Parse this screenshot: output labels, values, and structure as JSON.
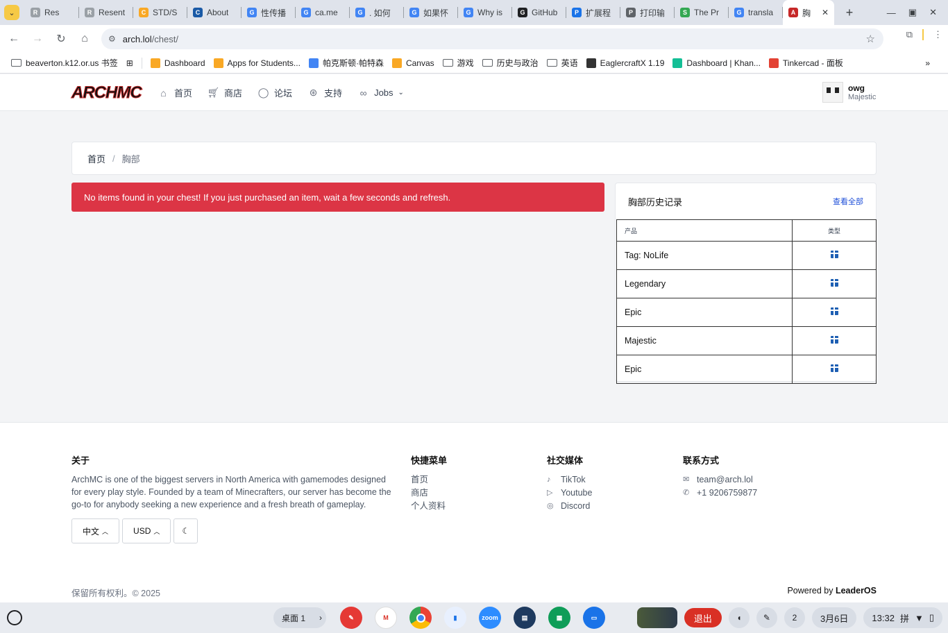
{
  "browser": {
    "tabs": [
      {
        "label": "Res",
        "fav": "R",
        "color": "#9aa0a6"
      },
      {
        "label": "Resent",
        "fav": "R",
        "color": "#9aa0a6"
      },
      {
        "label": "STD/S",
        "fav": "C",
        "color": "#f9a825"
      },
      {
        "label": "About",
        "fav": "CDC",
        "color": "#1a5aa6"
      },
      {
        "label": "性传播",
        "fav": "G",
        "color": "#4285f4"
      },
      {
        "label": "ca.me",
        "fav": "G",
        "color": "#4285f4"
      },
      {
        "label": ". 如何",
        "fav": "G",
        "color": "#4285f4"
      },
      {
        "label": "如果怀",
        "fav": "G",
        "color": "#4285f4"
      },
      {
        "label": "Why is",
        "fav": "G",
        "color": "#4285f4"
      },
      {
        "label": "GitHub",
        "fav": "GH",
        "color": "#202124"
      },
      {
        "label": "扩展程",
        "fav": "P",
        "color": "#1a73e8"
      },
      {
        "label": "打印输",
        "fav": "P",
        "color": "#5f6368"
      },
      {
        "label": "The Pr",
        "fav": "S",
        "color": "#34a853"
      },
      {
        "label": "transla",
        "fav": "G",
        "color": "#4285f4"
      },
      {
        "label": "胸",
        "fav": "A",
        "color": "#c62828"
      }
    ],
    "url_host": "arch.lol",
    "url_path": "/chest/"
  },
  "bookmarks": [
    {
      "label": "beaverton.k12.or.us 书签",
      "icon": "folder-icon"
    },
    {
      "label": "Dashboard",
      "icon": "canvas-icon"
    },
    {
      "label": "Apps for Students...",
      "icon": "canvas-icon"
    },
    {
      "label": "帕克斯顿·帕特森",
      "icon": "chrome-icon"
    },
    {
      "label": "Canvas",
      "icon": "canvas-icon"
    },
    {
      "label": "游戏",
      "icon": "folder-icon"
    },
    {
      "label": "历史与政治",
      "icon": "folder-icon"
    },
    {
      "label": "英语",
      "icon": "folder-icon"
    },
    {
      "label": "EaglercraftX 1.19",
      "icon": "eagler-icon"
    },
    {
      "label": "Dashboard | Khan...",
      "icon": "khan-icon"
    },
    {
      "label": "Tinkercad - 面板",
      "icon": "tinkercad-icon"
    }
  ],
  "site": {
    "logo": "ARCHMC",
    "nav": [
      "首页",
      "商店",
      "论坛",
      "支持",
      "Jobs"
    ],
    "user": {
      "name": "owg",
      "rank": "Majestic"
    }
  },
  "breadcrumb": {
    "home": "首页",
    "sep": "/",
    "current": "胸部"
  },
  "alert": "No items found in your chest! If you just purchased an item, wait a few seconds and refresh.",
  "history": {
    "title": "胸部历史记录",
    "view_all": "查看全部",
    "col_product": "产品",
    "col_type": "类型",
    "rows": [
      "Tag: NoLife",
      "Legendary",
      "Epic",
      "Majestic",
      "Epic"
    ]
  },
  "footer": {
    "about_title": "关于",
    "about_text": "ArchMC is one of the biggest servers in North America with gamemodes designed for every play style. Founded by a team of Minecrafters, our server has become the go-to for anybody seeking a new experience and a fresh breath of gameplay.",
    "quick_title": "快捷菜单",
    "quick_links": [
      "首页",
      "商店",
      "个人资料"
    ],
    "social_title": "社交媒体",
    "social_links": [
      "TikTok",
      "Youtube",
      "Discord"
    ],
    "contact_title": "联系方式",
    "email": "team@arch.lol",
    "phone": "+1 9206759877",
    "lang_btn": "中文",
    "currency_btn": "USD",
    "copyright": "保留所有权利。© 2025",
    "powered_prefix": "Powered by ",
    "powered_brand": "LeaderOS"
  },
  "shelf": {
    "desk": "桌面 1",
    "exit": "退出",
    "notif": "2",
    "date": "3月6日",
    "time": "13:32",
    "ime": "拼"
  }
}
